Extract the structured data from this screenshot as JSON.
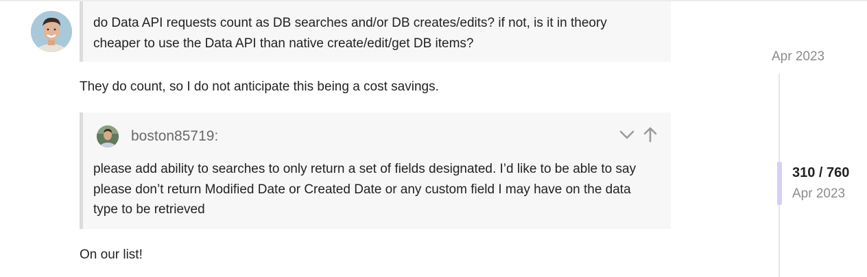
{
  "post": {
    "avatar_icon": "user-avatar",
    "quote_1": {
      "text": "do Data API requests count as DB searches and/or DB creates/edits? if not, is it in theory cheaper to use the Data API than native create/edit/get DB items?"
    },
    "reply_1": "They do count, so I do not anticipate this being a cost savings.",
    "quote_2": {
      "username": "boston85719:",
      "text": "please add ability to searches to only return a set of fields designated. I’d like to be able to say please don’t return Modified Date or Created Date or any custom field I may have on the data type to be retrieved",
      "expand_icon": "chevron-down-icon",
      "jump_icon": "arrow-up-icon"
    },
    "reply_2": "On our list!"
  },
  "timeline": {
    "top_date": "Apr 2023",
    "position": "310 / 760",
    "current_date": "Apr 2023",
    "progress_fraction": 0.408,
    "accent_color": "#d7d0f4"
  }
}
